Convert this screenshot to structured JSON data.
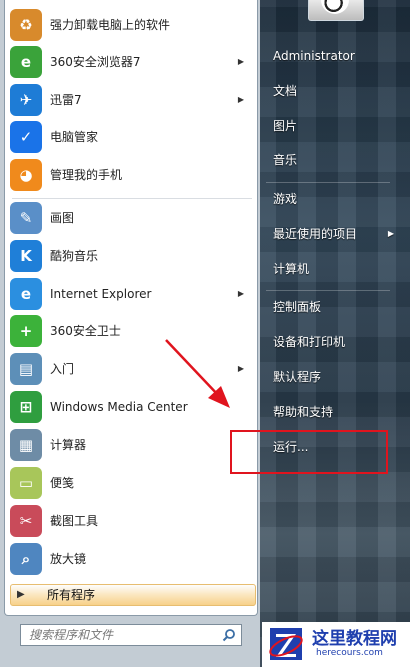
{
  "left_menu": {
    "pinned": [
      {
        "label": "强力卸载电脑上的软件",
        "icon": "uninstall-box-icon",
        "color": "#d88a2c",
        "glyph": "♻",
        "arrow": false
      },
      {
        "label": "360安全浏览器7",
        "icon": "360-browser-icon",
        "color": "#3aa33a",
        "glyph": "e",
        "arrow": true
      },
      {
        "label": "迅雷7",
        "icon": "thunder-bird-icon",
        "color": "#1e7cd6",
        "glyph": "✈",
        "arrow": true
      },
      {
        "label": "电脑管家",
        "icon": "shield-check-icon",
        "color": "#1a73e8",
        "glyph": "✓",
        "arrow": false
      },
      {
        "label": "管理我的手机",
        "icon": "phone-manager-icon",
        "color": "#f08a1c",
        "glyph": "◕",
        "arrow": false
      }
    ],
    "recent": [
      {
        "label": "画图",
        "icon": "paint-palette-icon",
        "color": "#5a8fc8",
        "glyph": "✎",
        "arrow": false
      },
      {
        "label": "酷狗音乐",
        "icon": "kugou-k-icon",
        "color": "#1f7fd8",
        "glyph": "K",
        "arrow": false
      },
      {
        "label": "Internet Explorer",
        "icon": "internet-explorer-icon",
        "color": "#2b8fe0",
        "glyph": "e",
        "arrow": true
      },
      {
        "label": "360安全卫士",
        "icon": "360-guard-icon",
        "color": "#3cb23a",
        "glyph": "+",
        "arrow": false
      },
      {
        "label": "入门",
        "icon": "getting-started-icon",
        "color": "#5d8fb8",
        "glyph": "▤",
        "arrow": true
      },
      {
        "label": "Windows Media Center",
        "icon": "windows-media-center-icon",
        "color": "#2f9e3f",
        "glyph": "⊞",
        "arrow": false
      },
      {
        "label": "计算器",
        "icon": "calculator-icon",
        "color": "#6e8ca6",
        "glyph": "▦",
        "arrow": false
      },
      {
        "label": "便笺",
        "icon": "sticky-notes-icon",
        "color": "#a8c65a",
        "glyph": "▭",
        "arrow": false
      },
      {
        "label": "截图工具",
        "icon": "scissors-icon",
        "color": "#c94b5a",
        "glyph": "✂",
        "arrow": false
      },
      {
        "label": "放大镜",
        "icon": "magnifier-icon",
        "color": "#4f86c0",
        "glyph": "⌕",
        "arrow": false
      }
    ],
    "all_programs": "所有程序",
    "search_placeholder": "搜索程序和文件"
  },
  "right_menu": {
    "items": [
      {
        "label": "Administrator",
        "arrow": false
      },
      {
        "label": "文档",
        "arrow": false
      },
      {
        "label": "图片",
        "arrow": false
      },
      {
        "label": "音乐",
        "arrow": false
      },
      {
        "label": "游戏",
        "arrow": false
      },
      {
        "label": "最近使用的项目",
        "arrow": true
      },
      {
        "label": "计算机",
        "arrow": false
      },
      {
        "label": "控制面板",
        "arrow": false
      },
      {
        "label": "设备和打印机",
        "arrow": false
      },
      {
        "label": "默认程序",
        "arrow": false
      },
      {
        "label": "帮助和支持",
        "arrow": false
      },
      {
        "label": "运行...",
        "arrow": false
      }
    ]
  },
  "watermark": {
    "title": "这里教程网",
    "url": "herecours.com"
  },
  "colors": {
    "highlight_box": "#e0141e",
    "watermark_blue": "#1f3fae"
  }
}
